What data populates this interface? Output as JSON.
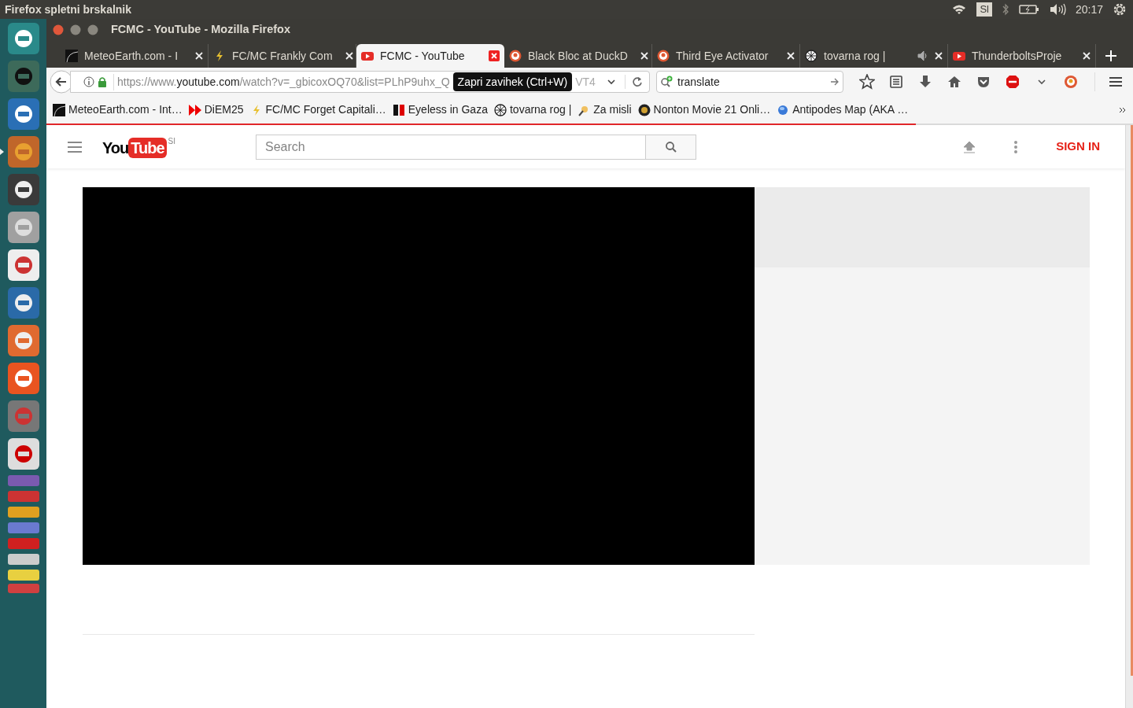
{
  "top_panel": {
    "app_title": "Firefox spletni brskalnik",
    "keyboard_layout": "Sl",
    "clock": "20:17"
  },
  "launcher": [
    {
      "running": false
    },
    {
      "running": false
    },
    {
      "running": false
    },
    {
      "running": true
    },
    {
      "running": false
    },
    {
      "running": false
    },
    {
      "running": false
    },
    {
      "running": false
    },
    {
      "running": false
    },
    {
      "running": false
    },
    {
      "running": false
    },
    {
      "running": false
    }
  ],
  "window": {
    "title": "FCMC - YouTube - Mozilla Firefox"
  },
  "tabs": [
    {
      "title": "MeteoEarth.com - I",
      "selected": false,
      "audio": false,
      "close_hover": false
    },
    {
      "title": "FC/MC Frankly Com",
      "selected": false,
      "audio": false,
      "close_hover": false
    },
    {
      "title": "FCMC - YouTube",
      "selected": true,
      "audio": false,
      "close_hover": true
    },
    {
      "title": "Black Bloc at DuckD",
      "selected": false,
      "audio": false,
      "close_hover": false
    },
    {
      "title": "Third Eye Activator",
      "selected": false,
      "audio": false,
      "close_hover": false
    },
    {
      "title": "tovarna rog |",
      "selected": false,
      "audio": true,
      "close_hover": false
    },
    {
      "title": "ThunderboltsProje",
      "selected": false,
      "audio": false,
      "close_hover": false
    }
  ],
  "nav": {
    "url_scheme": "https://www.",
    "url_host": "youtube.com",
    "url_path": "/watch?v=_gbicoxOQ70&list=PLhP9uhx_Q",
    "url_tail": "VT4",
    "tooltip": "Zapri zavihek (Ctrl+W)",
    "search_value": "translate"
  },
  "bookmarks": [
    {
      "title": "MeteoEarth.com - Int…"
    },
    {
      "title": "DiEM25"
    },
    {
      "title": "FC/MC Forget Capitali…"
    },
    {
      "title": "Eyeless in Gaza"
    },
    {
      "title": "tovarna rog |"
    },
    {
      "title": "Za misli"
    },
    {
      "title": "Nonton Movie 21 Onli…"
    },
    {
      "title": "Antipodes Map (AKA …"
    }
  ],
  "page_loading": {
    "level": 0.8
  },
  "youtube": {
    "logo_you": "You",
    "logo_tube": "Tube",
    "region": "SI",
    "search_placeholder": "Search",
    "sign_in": "SIGN IN"
  }
}
